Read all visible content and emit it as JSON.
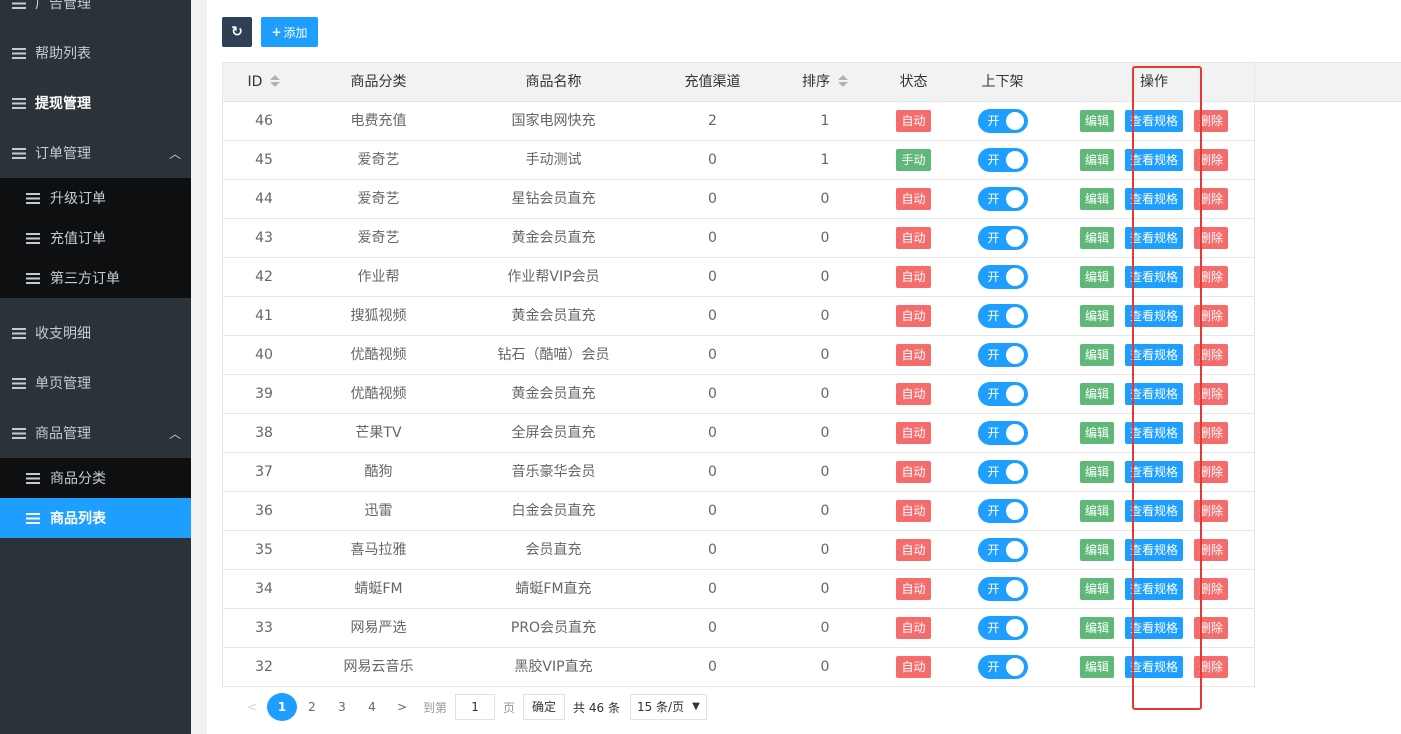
{
  "sidebar": {
    "top_item": {
      "label": "广告管理"
    },
    "items": [
      {
        "label": "帮助列表"
      },
      {
        "label": "提现管理"
      },
      {
        "label": "订单管理",
        "caret": "^"
      },
      {
        "label": "收支明细"
      },
      {
        "label": "单页管理"
      },
      {
        "label": "商品管理",
        "caret": "^"
      }
    ],
    "order_sub": [
      {
        "label": "升级订单"
      },
      {
        "label": "充值订单"
      },
      {
        "label": "第三方订单"
      }
    ],
    "goods_sub": [
      {
        "label": "商品分类"
      },
      {
        "label": "商品列表"
      }
    ]
  },
  "toolbar": {
    "refresh_icon": "↻",
    "add_icon": "+",
    "add_label": "添加"
  },
  "table": {
    "headers": {
      "id": "ID",
      "category": "商品分类",
      "name": "商品名称",
      "channel": "充值渠道",
      "sort": "排序",
      "status": "状态",
      "shelf": "上下架",
      "ops": "操作"
    },
    "rows": [
      {
        "id": "46",
        "category": "电费充值",
        "name": "国家电网快充",
        "channel": "2",
        "sort": "1",
        "status": "自动",
        "shelf": "开"
      },
      {
        "id": "45",
        "category": "爱奇艺",
        "name": "手动测试",
        "channel": "0",
        "sort": "1",
        "status": "手动",
        "shelf": "开"
      },
      {
        "id": "44",
        "category": "爱奇艺",
        "name": "星钻会员直充",
        "channel": "0",
        "sort": "0",
        "status": "自动",
        "shelf": "开"
      },
      {
        "id": "43",
        "category": "爱奇艺",
        "name": "黄金会员直充",
        "channel": "0",
        "sort": "0",
        "status": "自动",
        "shelf": "开"
      },
      {
        "id": "42",
        "category": "作业帮",
        "name": "作业帮VIP会员",
        "channel": "0",
        "sort": "0",
        "status": "自动",
        "shelf": "开"
      },
      {
        "id": "41",
        "category": "搜狐视频",
        "name": "黄金会员直充",
        "channel": "0",
        "sort": "0",
        "status": "自动",
        "shelf": "开"
      },
      {
        "id": "40",
        "category": "优酷视频",
        "name": "钻石（酷喵）会员",
        "channel": "0",
        "sort": "0",
        "status": "自动",
        "shelf": "开"
      },
      {
        "id": "39",
        "category": "优酷视频",
        "name": "黄金会员直充",
        "channel": "0",
        "sort": "0",
        "status": "自动",
        "shelf": "开"
      },
      {
        "id": "38",
        "category": "芒果TV",
        "name": "全屏会员直充",
        "channel": "0",
        "sort": "0",
        "status": "自动",
        "shelf": "开"
      },
      {
        "id": "37",
        "category": "酷狗",
        "name": "音乐豪华会员",
        "channel": "0",
        "sort": "0",
        "status": "自动",
        "shelf": "开"
      },
      {
        "id": "36",
        "category": "迅雷",
        "name": "白金会员直充",
        "channel": "0",
        "sort": "0",
        "status": "自动",
        "shelf": "开"
      },
      {
        "id": "35",
        "category": "喜马拉雅",
        "name": "会员直充",
        "channel": "0",
        "sort": "0",
        "status": "自动",
        "shelf": "开"
      },
      {
        "id": "34",
        "category": "蜻蜓FM",
        "name": "蜻蜓FM直充",
        "channel": "0",
        "sort": "0",
        "status": "自动",
        "shelf": "开"
      },
      {
        "id": "33",
        "category": "网易严选",
        "name": "PRO会员直充",
        "channel": "0",
        "sort": "0",
        "status": "自动",
        "shelf": "开"
      },
      {
        "id": "32",
        "category": "网易云音乐",
        "name": "黑胶VIP直充",
        "channel": "0",
        "sort": "0",
        "status": "自动",
        "shelf": "开"
      }
    ],
    "actions": {
      "edit": "编辑",
      "view_spec": "查看规格",
      "delete": "删除"
    }
  },
  "colors": {
    "status_auto": "#f56c6c",
    "status_manual": "#5fb878",
    "accent": "#1e9fff",
    "highlight": "#e53935"
  },
  "pagination": {
    "prev": "<",
    "next": ">",
    "pages": [
      "1",
      "2",
      "3",
      "4"
    ],
    "current": "1",
    "goto_label": "到第",
    "goto_value": "1",
    "page_label": "页",
    "confirm": "确定",
    "total": "共 46 条",
    "per_page": "15 条/页"
  }
}
